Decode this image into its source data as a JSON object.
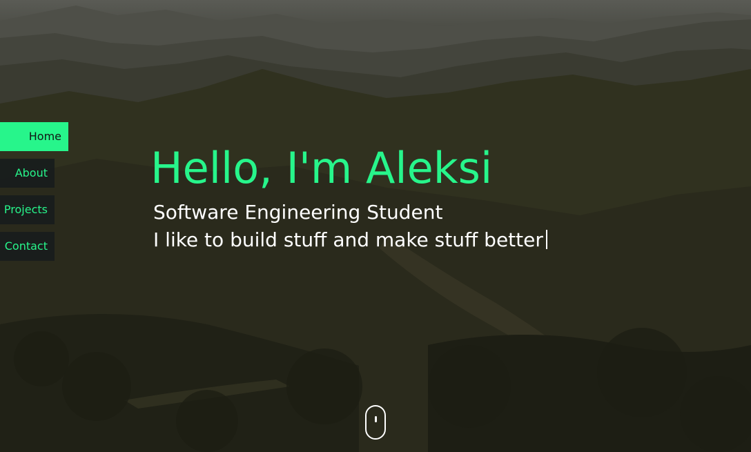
{
  "nav": {
    "items": [
      {
        "label": "Home",
        "active": true
      },
      {
        "label": "About",
        "active": false
      },
      {
        "label": "Projects",
        "active": false
      },
      {
        "label": "Contact",
        "active": false
      }
    ]
  },
  "hero": {
    "title": "Hello, I'm Aleksi",
    "subtitle": "Software Engineering Student",
    "tagline": "I like to build stuff and make stuff better"
  },
  "icons": {
    "scroll": "mouse-scroll-icon"
  },
  "colors": {
    "accent": "#27f58b",
    "nav_bg": "#181c1c",
    "text": "#ffffff"
  }
}
